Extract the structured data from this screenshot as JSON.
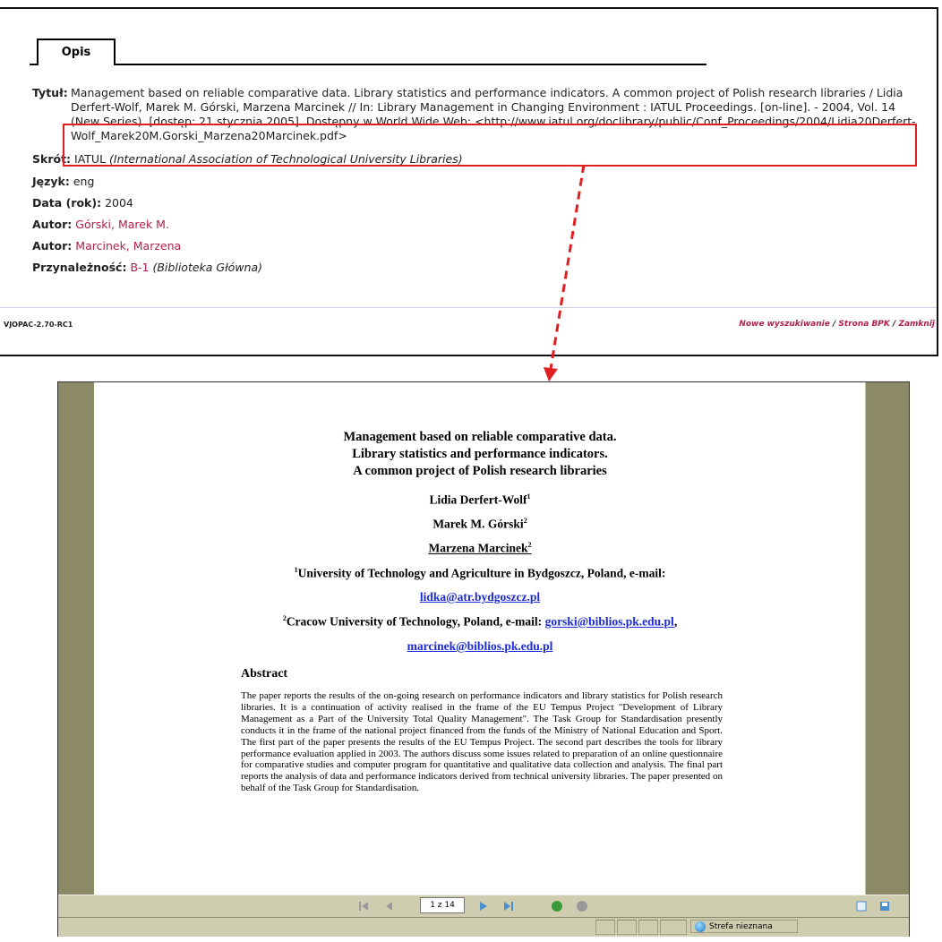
{
  "opac": {
    "tab_label": "Opis",
    "title": {
      "label": "Tytuł:",
      "value": "Management based on reliable comparative data. Library statistics and performance indicators. A common project of Polish research libraries / Lidia Derfert-Wolf, Marek M. Górski, Marzena Marcinek // In: Library Management in Changing Environment : IATUL Proceedings. [on-line]. - 2004, Vol. 14 (New Series). [dostęp: 21 stycznia 2005]. Dostępny w World Wide Web:",
      "url": "<http://www.iatul.org/doclibrary/public/Conf_Proceedings/2004/Lidia20Derfert-Wolf_Marek20M.Gorski_Marzena20Marcinek.pdf>"
    },
    "skrot": {
      "label": "Skrót:",
      "value": "IATUL",
      "expansion": "(International Association of Technological University Libraries)"
    },
    "jezyk": {
      "label": "Język:",
      "value": "eng"
    },
    "data": {
      "label": "Data (rok):",
      "value": "2004"
    },
    "autor1": {
      "label": "Autor:",
      "value": "Górski, Marek M."
    },
    "autor2": {
      "label": "Autor:",
      "value": "Marcinek, Marzena"
    },
    "przynaleznosc": {
      "label": "Przynależność:",
      "value": "B-1",
      "desc": "(Biblioteka Główna)"
    },
    "version": "VJOPAC-2.70-RC1",
    "footer_links": [
      "Nowe wyszukiwanie",
      "Strona BPK",
      "Zamknij"
    ],
    "footer_sep": "/",
    "highlight_color": "#e02020"
  },
  "pdf": {
    "title_lines": [
      "Management based on reliable comparative data.",
      "Library statistics and performance indicators.",
      "A common project of Polish research libraries"
    ],
    "authors": [
      "Lidia Derfert-Wolf",
      "Marek M. Górski",
      "Marzena Marcinek"
    ],
    "author_sups": [
      "1",
      "2",
      "2"
    ],
    "aff1_sup": "1",
    "aff1": "University of Technology and Agriculture in Bydgoszcz, Poland, e-mail:",
    "email1": "lidka@atr.bydgoszcz.pl",
    "aff2_sup": "2",
    "aff2": "Cracow University of Technology, Poland, e-mail:",
    "email2": "gorski@biblios.pk.edu.pl",
    "email2_suffix": ",",
    "email3": "marcinek@biblios.pk.edu.pl",
    "abstract_heading": "Abstract",
    "abstract": "The paper reports the results of the on-going research on performance indicators and library statistics for Polish research libraries. It is a continuation of activity realised in the frame of the EU Tempus Project \"Development of Library Management as a Part of the University Total Quality Management\". The Task Group for Standardisation presently conducts it in the frame of the national project financed from the funds of the Ministry of National Education and Sport. The first part of the paper presents the results of the EU Tempus Project. The second part describes the tools for library performance evaluation applied in 2003. The authors discuss some issues related to preparation of an online questionnaire for comparative studies and computer program for quantitative and qualitative data collection and analysis. The final part reports the analysis of data and performance indicators derived from technical university libraries. The paper presented on behalf of the Task Group for Standardisation."
  },
  "viewer": {
    "page_indicator": "1 z 14",
    "status_zone": "Strefa nieznana",
    "icons": [
      "first-page-icon",
      "prev-page-icon",
      "next-page-icon",
      "last-page-icon",
      "go-back-icon",
      "go-forward-icon",
      "single-page-icon",
      "save-icon",
      "globe-icon"
    ]
  }
}
